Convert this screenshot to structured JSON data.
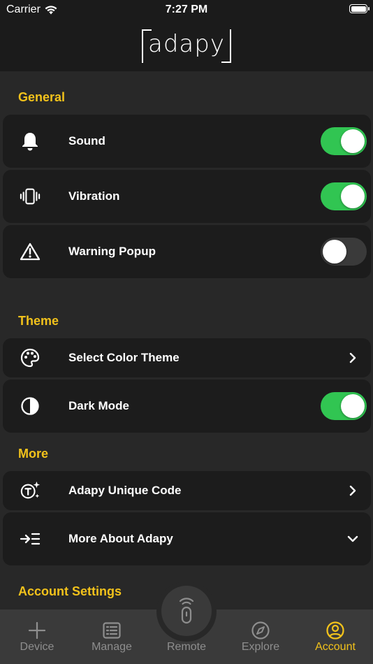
{
  "status_bar": {
    "carrier": "Carrier",
    "time": "7:27 PM"
  },
  "header": {
    "logo": "adapy"
  },
  "sections": {
    "general": {
      "title": "General",
      "rows": [
        {
          "label": "Sound",
          "icon": "bell-icon",
          "toggle": true
        },
        {
          "label": "Vibration",
          "icon": "vibration-icon",
          "toggle": true
        },
        {
          "label": "Warning Popup",
          "icon": "warning-icon",
          "toggle": false
        }
      ]
    },
    "theme": {
      "title": "Theme",
      "rows": [
        {
          "label": "Select Color Theme",
          "icon": "palette-icon",
          "accessory": "chevron-right-icon"
        },
        {
          "label": "Dark Mode",
          "icon": "contrast-icon",
          "toggle": true
        }
      ]
    },
    "more": {
      "title": "More",
      "rows": [
        {
          "label": "Adapy Unique Code",
          "icon": "sparkle-code-icon",
          "accessory": "chevron-right-icon"
        },
        {
          "label": "More About Adapy",
          "icon": "indent-list-icon",
          "accessory": "chevron-down-icon"
        }
      ]
    },
    "account_settings": {
      "title": "Account Settings"
    }
  },
  "tabbar": {
    "tabs": [
      {
        "label": "Device",
        "icon": "plus-icon"
      },
      {
        "label": "Manage",
        "icon": "list-icon"
      },
      {
        "label": "Remote",
        "icon": "remote-icon"
      },
      {
        "label": "Explore",
        "icon": "compass-icon"
      },
      {
        "label": "Account",
        "icon": "user-circle-icon"
      }
    ],
    "active": "Account"
  },
  "colors": {
    "accent": "#f2c21b",
    "toggle_on": "#31c552",
    "background": "#282828",
    "card": "#1c1c1c"
  }
}
